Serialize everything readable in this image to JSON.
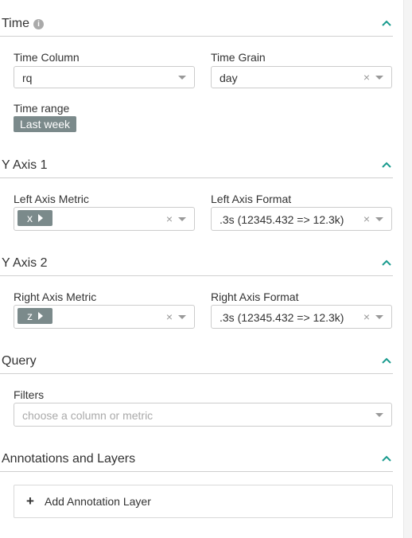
{
  "sections": {
    "time": {
      "title": "Time",
      "time_column": {
        "label": "Time Column",
        "value": "rq"
      },
      "time_grain": {
        "label": "Time Grain",
        "value": "day"
      },
      "time_range": {
        "label": "Time range",
        "value": "Last week"
      }
    },
    "y_axis_1": {
      "title": "Y Axis 1",
      "metric": {
        "label": "Left Axis Metric",
        "tag": "x"
      },
      "format": {
        "label": "Left Axis Format",
        "value": ".3s (12345.432 => 12.3k)"
      }
    },
    "y_axis_2": {
      "title": "Y Axis 2",
      "metric": {
        "label": "Right Axis Metric",
        "tag": "z"
      },
      "format": {
        "label": "Right Axis Format",
        "value": ".3s (12345.432 => 12.3k)"
      }
    },
    "query": {
      "title": "Query",
      "filters": {
        "label": "Filters",
        "placeholder": "choose a column or metric"
      }
    },
    "annotations": {
      "title": "Annotations and Layers",
      "add_button": "Add Annotation Layer"
    }
  },
  "icons": {
    "collapse": "chevron-up-icon",
    "info": "info-icon",
    "clear": "clear-x-icon",
    "dropdown": "caret-down-icon",
    "plus": "plus-icon"
  },
  "colors": {
    "accent": "#1a9b8e",
    "tag_bg": "#7b8a8b",
    "border": "#cccccc",
    "text": "#333333",
    "placeholder": "#aaaaaa"
  },
  "clear_symbol": "×",
  "info_symbol": "i",
  "plus_symbol": "+"
}
